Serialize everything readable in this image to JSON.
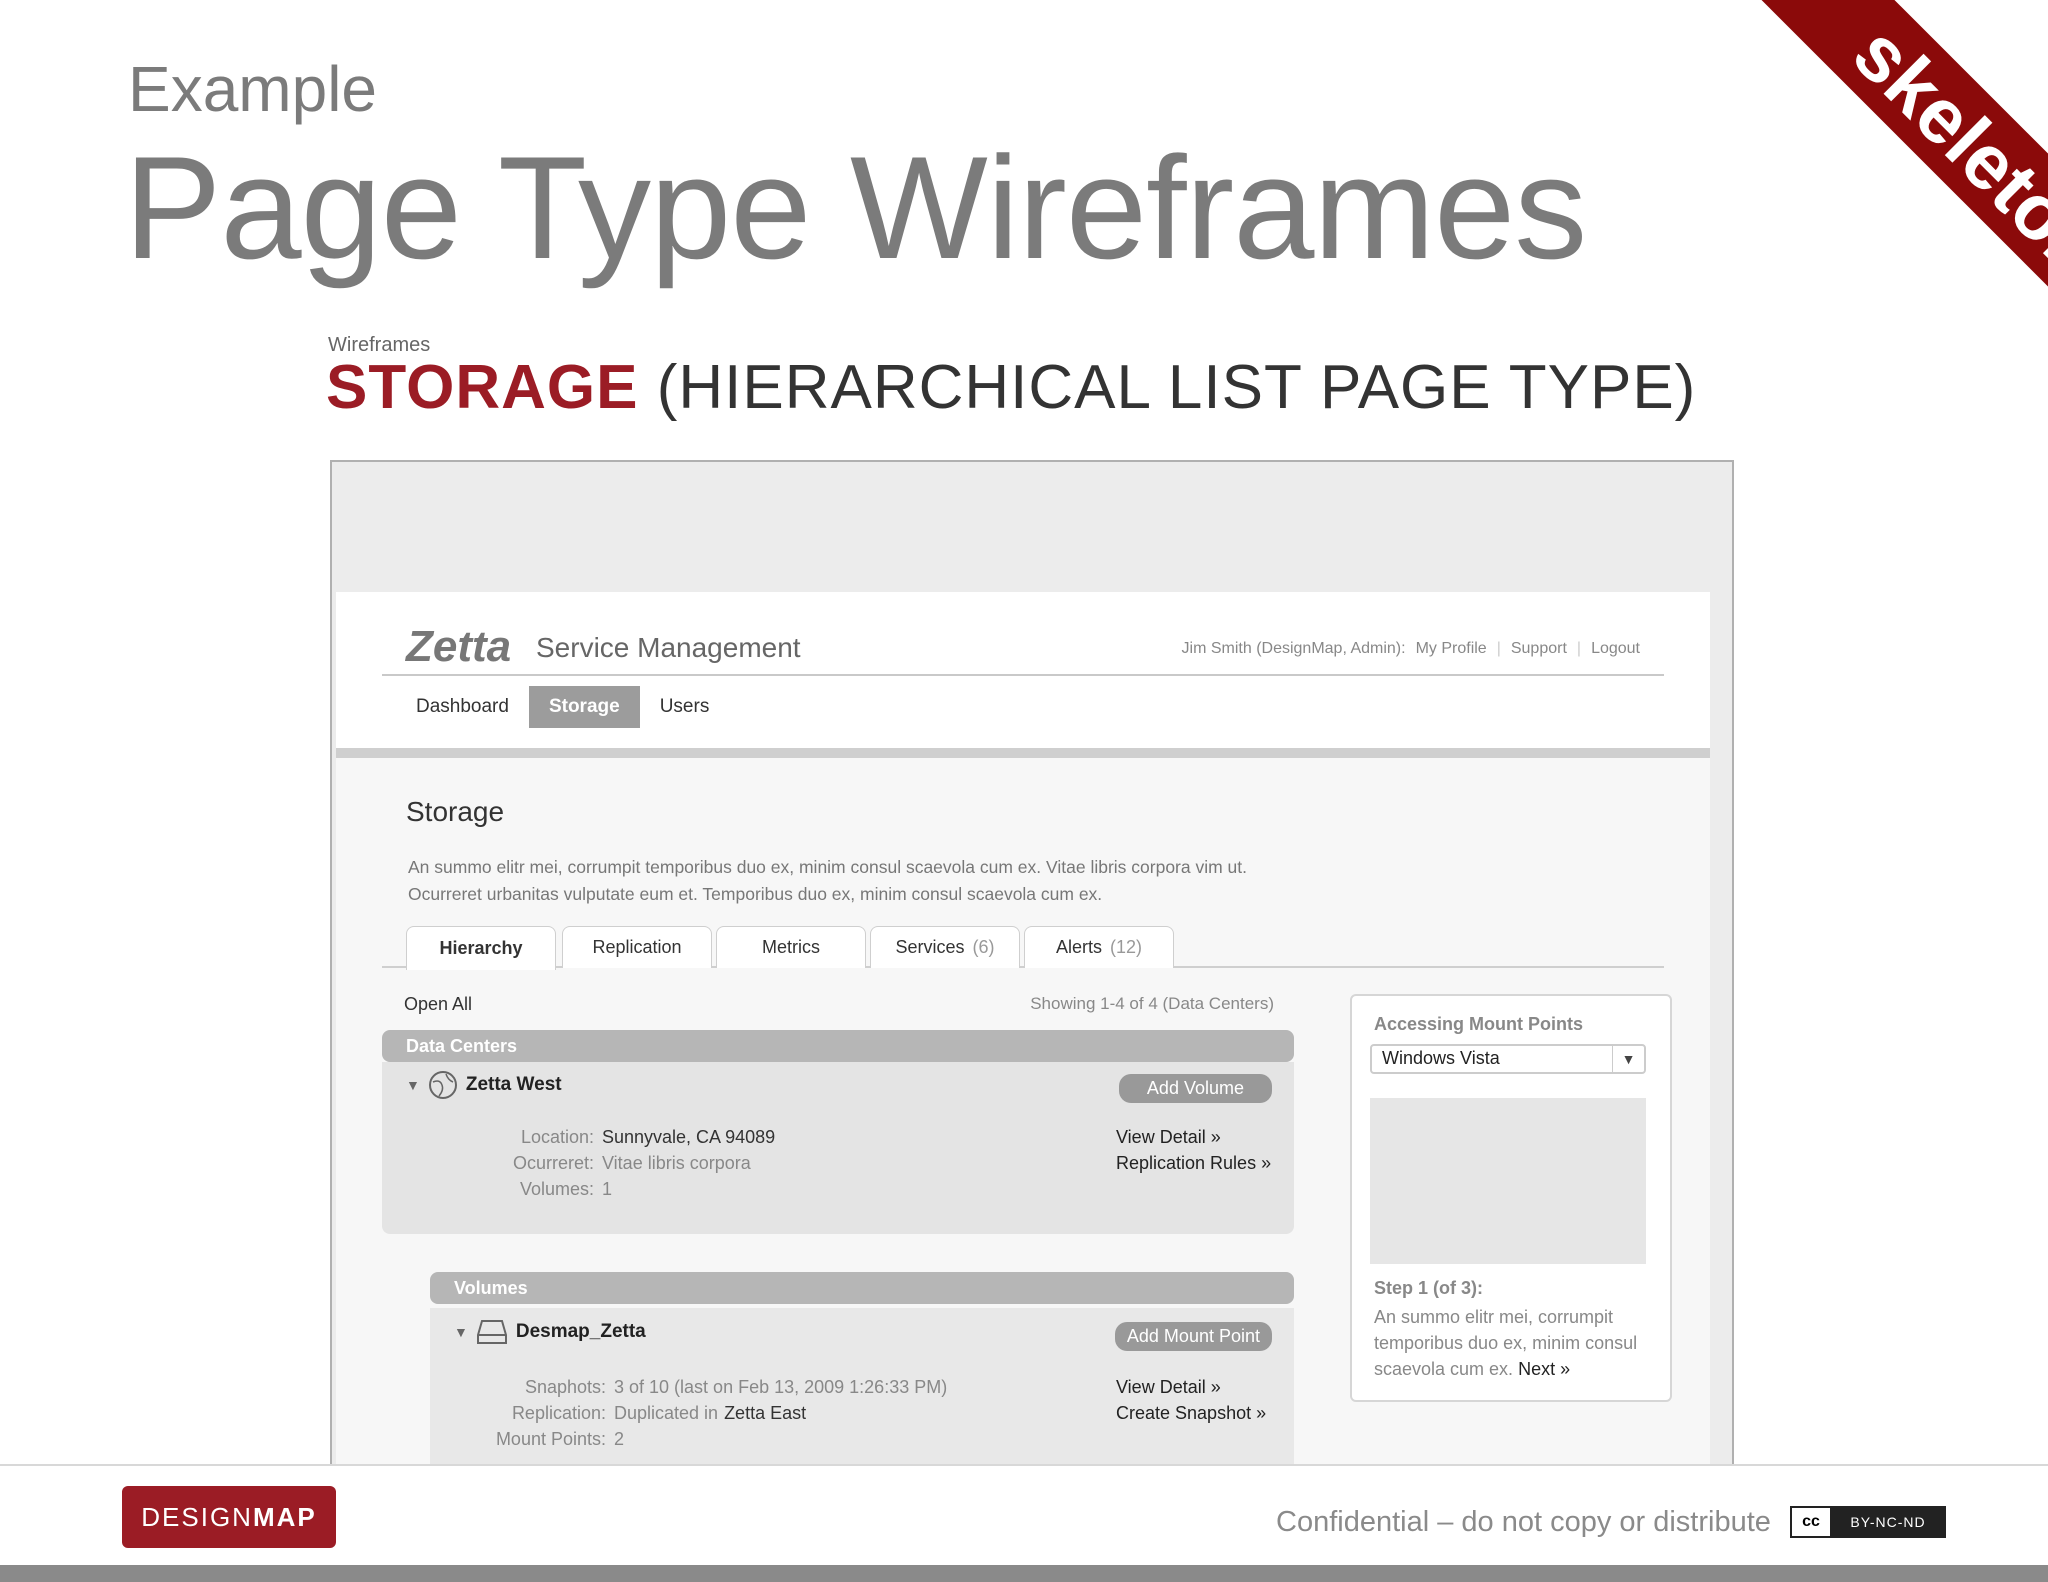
{
  "slide": {
    "kicker": "Example",
    "title": "Page Type Wireframes",
    "ribbon": "skeleton"
  },
  "wireframe": {
    "label": "Wireframes",
    "heading_strong": "STORAGE",
    "heading_rest": "(HIERARCHICAL LIST PAGE TYPE)"
  },
  "app": {
    "brand": "Zetta",
    "brand_sub": "Service Management",
    "user": "Jim Smith (DesignMap, Admin):",
    "user_links": [
      "My Profile",
      "Support",
      "Logout"
    ],
    "nav": [
      "Dashboard",
      "Storage",
      "Users"
    ],
    "active_nav": "Storage"
  },
  "page": {
    "title": "Storage",
    "description": "An summo elitr mei, corrumpit temporibus duo ex, minim consul scaevola cum ex. Vitae libris corpora vim ut. Ocurreret urbanitas vulputate eum et. Temporibus duo ex, minim consul scaevola cum ex."
  },
  "tabs": [
    {
      "label": "Hierarchy",
      "count": ""
    },
    {
      "label": "Replication",
      "count": ""
    },
    {
      "label": "Metrics",
      "count": ""
    },
    {
      "label": "Services",
      "count": "(6)"
    },
    {
      "label": "Alerts",
      "count": "(12)"
    }
  ],
  "list": {
    "open_all": "Open All",
    "showing": "Showing 1-4 of 4 (Data Centers)",
    "data_centers_label": "Data Centers",
    "data_center": {
      "name": "Zetta West",
      "action": "Add Volume",
      "fields": [
        {
          "key": "Location:",
          "value": "Sunnyvale, CA 94089"
        },
        {
          "key": "Ocurreret:",
          "value": "Vitae libris corpora"
        },
        {
          "key": "Volumes:",
          "value": "1"
        }
      ],
      "links": [
        "View Detail »",
        "Replication Rules »"
      ]
    },
    "volumes_label": "Volumes",
    "volume": {
      "name": "Desmap_Zetta",
      "action": "Add Mount Point",
      "fields": [
        {
          "key": "Snaphots:",
          "value": "3 of 10 (last on Feb 13, 2009 1:26:33 PM)"
        },
        {
          "key": "Replication:",
          "value_prefix": "Duplicated in",
          "value": "Zetta East"
        },
        {
          "key": "Mount Points:",
          "value": "2"
        }
      ],
      "links": [
        "View Detail »",
        "Create Snapshot »"
      ]
    }
  },
  "sidebar": {
    "title": "Accessing Mount Points",
    "select_value": "Windows Vista",
    "step": "Step 1 (of 3):",
    "text": "An summo elitr mei, corrumpit temporibus duo ex, minim consul scaevola cum ex.",
    "next": "Next »"
  },
  "footer": {
    "logo_thin": "DESIGN",
    "logo_bold": "MAP",
    "confidential": "Confidential – do not copy or distribute",
    "cc": "cc",
    "license": "BY-NC-ND"
  },
  "colors": {
    "brand_red": "#9b1c25",
    "ribbon_red": "#8b0a0a",
    "title_gray": "#7b7b7b"
  }
}
